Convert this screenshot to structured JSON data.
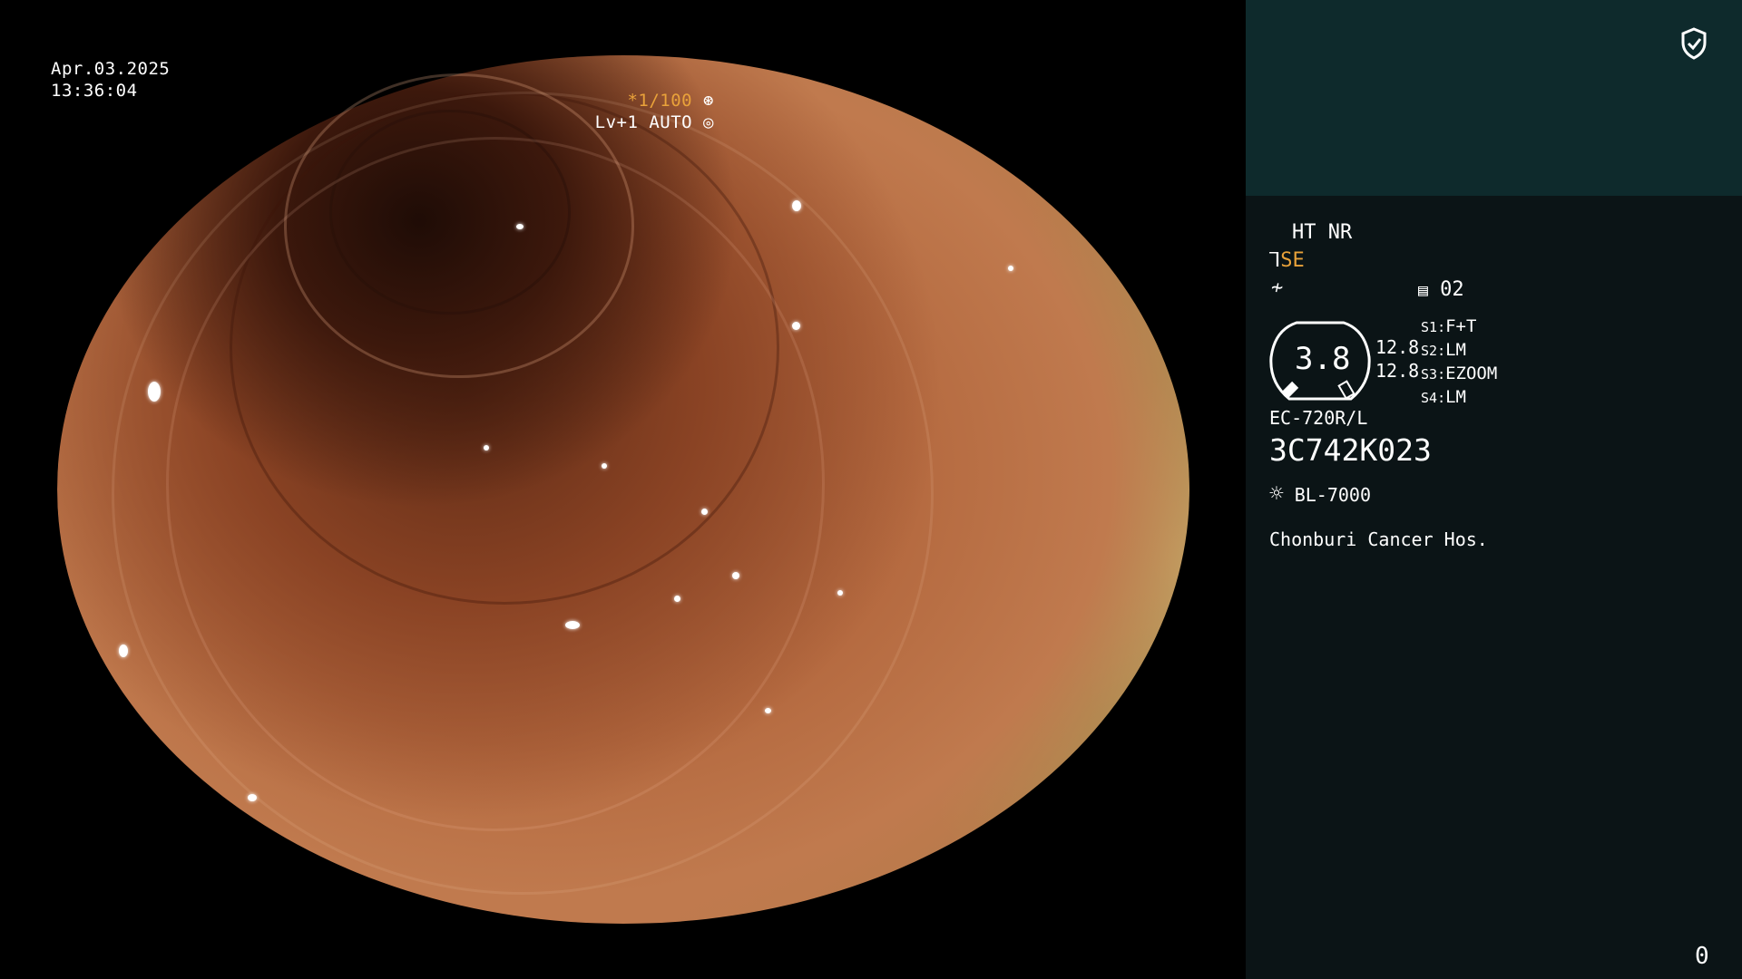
{
  "overlay": {
    "date": "Apr.03.2025",
    "time": "13:36:04",
    "shutter": "*1/100",
    "level": "Lv+1 AUTO"
  },
  "panel": {
    "mode_line": "HT NR",
    "se_label": "SE",
    "record_icon_label": "02",
    "gauge_value": "3.8",
    "gauge_right_1": "12.8",
    "gauge_right_2": "12.8",
    "switches": [
      {
        "key": "S1",
        "value": "F+T"
      },
      {
        "key": "S2",
        "value": "LM"
      },
      {
        "key": "S3",
        "value": "EZOOM"
      },
      {
        "key": "S4",
        "value": "LM"
      }
    ],
    "scope_model": "EC-720R/L",
    "scope_serial": "3C742K023",
    "light_source": "BL-7000",
    "hospital": "Chonburi Cancer Hos.",
    "counter": "0"
  },
  "colors": {
    "accent": "#e9a23a",
    "panel_bg": "#0b1416",
    "panel_top_bg": "#0e2a2c"
  },
  "icons": [
    "shield-check-icon",
    "aperture-icon",
    "iris-icon",
    "scope-tip-icon",
    "freeze-icon",
    "record-icon",
    "light-source-icon"
  ]
}
